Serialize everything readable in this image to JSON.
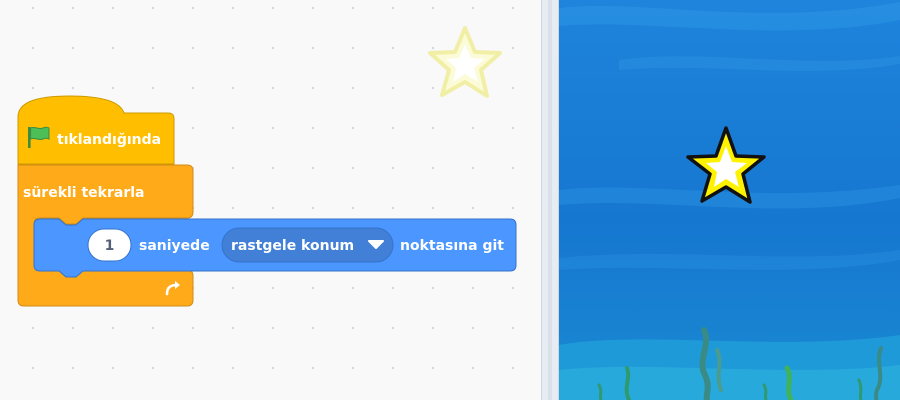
{
  "workspace": {
    "event_block": {
      "label": "tıklandığında",
      "icon": "green-flag-icon"
    },
    "forever_block": {
      "label": "sürekli tekrarla",
      "loop_icon": "loop-arrow-icon"
    },
    "glide_block": {
      "duration_value": "1",
      "label_seconds": "saniyede",
      "target_dropdown": "rastgele konum",
      "label_suffix": "noktasına git"
    },
    "ghost_sprite_icon": "star-icon"
  },
  "stage": {
    "sprite_icon": "star-icon",
    "backdrop": "underwater"
  },
  "colors": {
    "events": "#ffbf00",
    "control": "#ffab19",
    "motion": "#4c97ff",
    "motion_dropdown": "#4280d7",
    "stage_water": "#1c7ad4"
  }
}
